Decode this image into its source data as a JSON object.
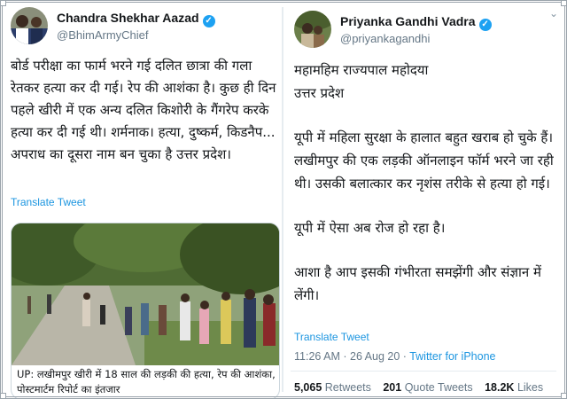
{
  "left_tweet": {
    "name": "Chandra Shekhar Aazad",
    "handle": "@BhimArmyChief",
    "text": "बोर्ड परीक्षा का फार्म भरने गई दलित छात्रा की गला रेतकर हत्या कर दी गई। रेप की आशंका है। कुछ ही दिन पहले खीरी में एक अन्य दलित किशोरी के गैंगरेप करके हत्या कर दी गई थी। शर्मनाक। हत्या, दुष्कर्म, किडनैप... अपराध का दूसरा नाम बन चुका है उत्तर प्रदेश।",
    "translate": "Translate Tweet",
    "card_caption": "UP: लखीमपुर खीरी में 18 साल की लड़की की हत्या, रेप की आशंका, पोस्टमार्टम रिपोर्ट का इंतजार"
  },
  "right_tweet": {
    "name": "Priyanka Gandhi Vadra",
    "handle": "@priyankagandhi",
    "paragraphs": [
      "महामहिम राज्यपाल महोदया",
      "उत्तर प्रदेश",
      "",
      "यूपी में महिला सुरक्षा के हालात बहुत खराब हो चुके हैं। लखीमपुर की एक लड़की ऑनलाइन फॉर्म भरने जा रही थी। उसकी बलात्कार कर नृशंस तरीके से हत्या हो गई।",
      "",
      "यूपी में ऐसा अब रोज हो रहा है।",
      "",
      "आशा है आप इसकी गंभीरता समझेंगी और संज्ञान में लेंगी।"
    ],
    "translate": "Translate Tweet",
    "time": "11:26 AM",
    "date": "26 Aug 20",
    "source": "Twitter for iPhone",
    "retweets_count": "5,065",
    "retweets_label": "Retweets",
    "quotes_count": "201",
    "quotes_label": "Quote Tweets",
    "likes_count": "18.2K",
    "likes_label": "Likes"
  },
  "icons": {
    "verified": "verified-badge-icon",
    "more": "chevron-down-icon"
  },
  "colors": {
    "link": "#1b95e0",
    "verified": "#1da1f2",
    "secondary_text": "#657786"
  }
}
